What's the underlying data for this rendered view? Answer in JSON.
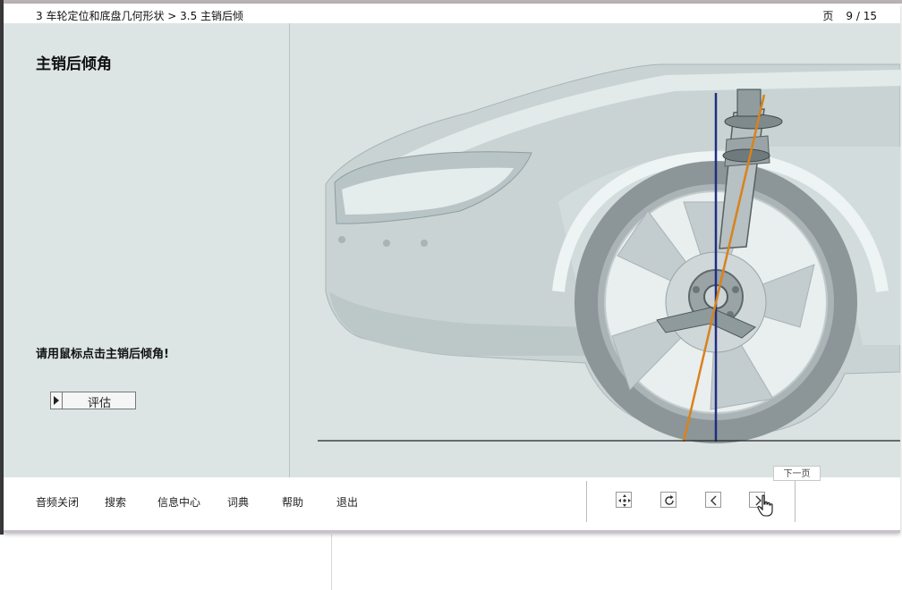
{
  "header": {
    "breadcrumb": "3 车轮定位和底盘几何形状 > 3.5 主销后倾",
    "page_label": "页",
    "page_number": "9 / 15"
  },
  "left_panel": {
    "heading": "主销后倾角",
    "instruction": "请用鼠标点击主销后倾角!",
    "evaluate_button": "评估"
  },
  "bottom_menu": {
    "items": [
      "音频关闭",
      "搜索",
      "信息中心",
      "词典",
      "帮助",
      "退出"
    ]
  },
  "nav": {
    "tooltip": "下一页",
    "icons": [
      "move-icon",
      "reload-icon",
      "chevron-left-icon",
      "chevron-right-icon"
    ]
  },
  "colors": {
    "background": "#dbe2e2",
    "vertical_line": "#1f2e80",
    "steering_axis": "#d9821c"
  }
}
